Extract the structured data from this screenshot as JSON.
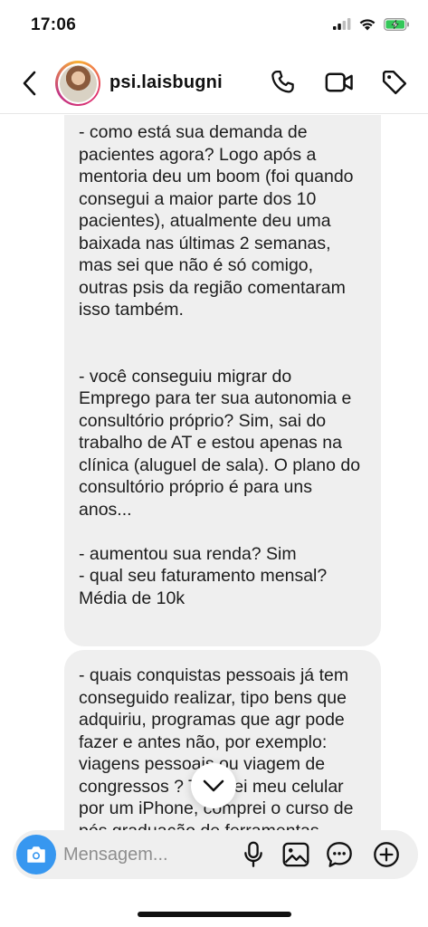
{
  "status_bar": {
    "time": "17:06",
    "icons": [
      "signal-icon",
      "wifi-icon",
      "battery-charging-icon"
    ],
    "battery_color": "#34c759"
  },
  "header": {
    "username": "psi.laisbugni",
    "icons": [
      "back-icon",
      "phone-icon",
      "video-icon",
      "tag-icon"
    ]
  },
  "messages": [
    {
      "text": "- como está sua demanda de pacientes agora? Logo após a mentoria deu um boom (foi quando consegui a maior parte dos 10 pacientes), atualmente deu uma baixada nas últimas 2 semanas, mas sei que não é só comigo, outras psis da região comentaram isso também.\n\n\n- você conseguiu migrar do Emprego para ter sua autonomia e consultório próprio? Sim, sai do trabalho de AT e estou apenas na clínica (aluguel de sala). O plano do consultório próprio é para uns anos...\n\n- aumentou sua renda? Sim\n- qual seu faturamento mensal? Média de 10k"
    },
    {
      "text": "- quais conquistas pessoais já tem conseguido realizar, tipo bens que adquiriu, programas  que agr pode fazer e antes não, por exemplo: viagens pessoais ou viagem de congressos ? Troquei meu celular por um iPhone, comprei o curso de pós graduação de ferramentas"
    }
  ],
  "composer": {
    "placeholder": "Mensagem...",
    "value": "",
    "accent_color": "#3797f0",
    "icons": [
      "camera-icon",
      "microphone-icon",
      "gallery-icon",
      "sticker-icon",
      "add-icon"
    ]
  },
  "scroll_button": {
    "icon": "chevron-down-icon"
  }
}
